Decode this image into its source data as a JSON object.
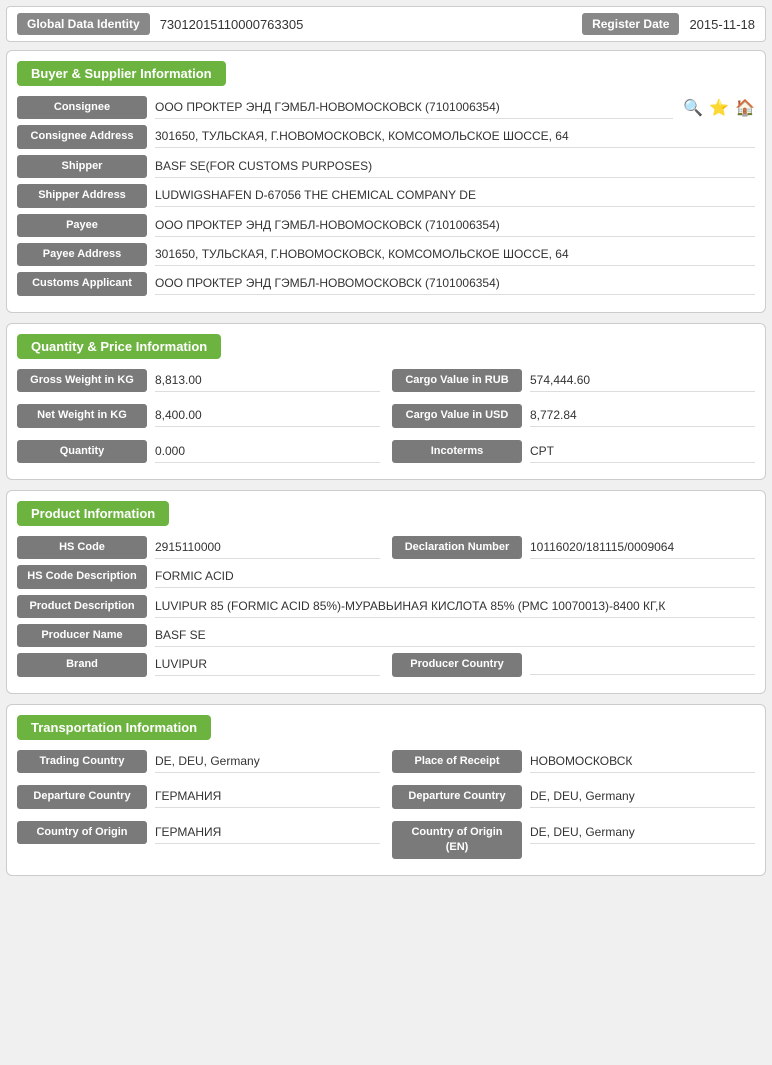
{
  "header": {
    "global_data_identity_label": "Global Data Identity",
    "global_data_identity_value": "73012015110000763305",
    "register_date_label": "Register Date",
    "register_date_value": "2015-11-18"
  },
  "buyer_supplier": {
    "section_title": "Buyer & Supplier Information",
    "fields": [
      {
        "label": "Consignee",
        "value": "ООО ПРОКТЕР ЭНД ГЭМБЛ-НОВОМОСКОВСК (7101006354)"
      },
      {
        "label": "Consignee Address",
        "value": "301650, ТУЛЬСКАЯ, Г.НОВОМОСКОВСК, КОМСОМОЛЬСКОЕ ШОССЕ, 64"
      },
      {
        "label": "Shipper",
        "value": "BASF SE(FOR CUSTOMS PURPOSES)"
      },
      {
        "label": "Shipper Address",
        "value": "LUDWIGSHAFEN D-67056 THE CHEMICAL COMPANY DE"
      },
      {
        "label": "Payee",
        "value": "ООО ПРОКТЕР ЭНД ГЭМБЛ-НОВОМОСКОВСК (7101006354)"
      },
      {
        "label": "Payee Address",
        "value": "301650, ТУЛЬСКАЯ, Г.НОВОМОСКОВСК, КОМСОМОЛЬСКОЕ ШОССЕ, 64"
      },
      {
        "label": "Customs Applicant",
        "value": "ООО ПРОКТЕР ЭНД ГЭМБЛ-НОВОМОСКОВСК (7101006354)"
      }
    ],
    "icons": {
      "search": "🔍",
      "star": "⭐",
      "home": "🏠"
    }
  },
  "quantity_price": {
    "section_title": "Quantity & Price Information",
    "left_fields": [
      {
        "label": "Gross Weight in KG",
        "value": "8,813.00"
      },
      {
        "label": "Net Weight in KG",
        "value": "8,400.00"
      },
      {
        "label": "Quantity",
        "value": "0.000"
      }
    ],
    "right_fields": [
      {
        "label": "Cargo Value in RUB",
        "value": "574,444.60"
      },
      {
        "label": "Cargo Value in USD",
        "value": "8,772.84"
      },
      {
        "label": "Incoterms",
        "value": "CPT"
      }
    ]
  },
  "product": {
    "section_title": "Product Information",
    "hs_code_label": "HS Code",
    "hs_code_value": "2915110000",
    "declaration_number_label": "Declaration Number",
    "declaration_number_value": "10116020/181115/0009064",
    "hs_code_desc_label": "HS Code Description",
    "hs_code_desc_value": "FORMIC ACID",
    "product_desc_label": "Product Description",
    "product_desc_value": "LUVIPUR 85 (FORMIC ACID 85%)-МУРАВЬИНАЯ КИСЛОТА 85% (РМС 10070013)-8400 КГ,К",
    "producer_name_label": "Producer Name",
    "producer_name_value": "BASF SE",
    "brand_label": "Brand",
    "brand_value": "LUVIPUR",
    "producer_country_label": "Producer Country",
    "producer_country_value": ""
  },
  "transportation": {
    "section_title": "Transportation Information",
    "fields_left": [
      {
        "label": "Trading Country",
        "value": "DE, DEU, Germany"
      },
      {
        "label": "Departure Country",
        "value": "ГЕРМАНИЯ"
      },
      {
        "label": "Country of Origin",
        "value": "ГЕРМАНИЯ"
      }
    ],
    "fields_right": [
      {
        "label": "Place of Receipt",
        "value": "НОВОМОСКОВСК"
      },
      {
        "label": "Departure Country",
        "value": "DE, DEU, Germany"
      },
      {
        "label": "Country of Origin (EN)",
        "value": "DE, DEU, Germany"
      }
    ]
  }
}
